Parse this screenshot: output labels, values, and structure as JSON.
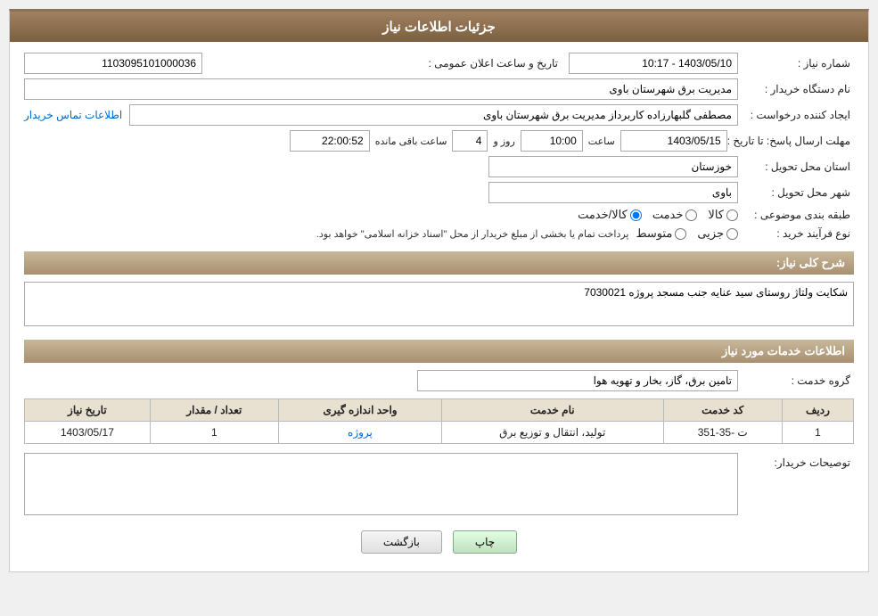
{
  "header": {
    "title": "جزئیات اطلاعات نیاز"
  },
  "fields": {
    "shomara_niaz_label": "شماره نیاز :",
    "shomara_niaz_value": "1103095101000036",
    "nam_dastgah_label": "نام دستگاه خریدار :",
    "nam_dastgah_value": "مدیریت برق شهرستان باوی",
    "ijad_konande_label": "ایجاد کننده درخواست :",
    "ijad_konande_value": "مصطفی گلبهارزاده کاربرداز مدیریت برق شهرستان باوی",
    "ettelaat_tamas_link": "اطلاعات تماس خریدار",
    "mohlat_label": "مهلت ارسال پاسخ: تا تاریخ :",
    "date_value": "1403/05/15",
    "saat_label": "ساعت",
    "saat_value": "10:00",
    "roz_label": "روز و",
    "roz_value": "4",
    "bagi_mande_label": "ساعت باقی مانده",
    "bagi_mande_value": "22:00:52",
    "ostan_label": "استان محل تحویل :",
    "ostan_value": "خوزستان",
    "shahr_label": "شهر محل تحویل :",
    "shahr_value": "باوی",
    "tabaqe_label": "طبقه بندی موضوعی :",
    "radio_kala_label": "کالا",
    "radio_khedmat_label": "خدمت",
    "radio_kala_khedmat_label": "کالا/خدمت",
    "radio_kala_checked": false,
    "radio_khedmat_checked": false,
    "radio_kala_khedmat_checked": true,
    "noe_farayand_label": "نوع فرآیند خرید :",
    "radio_jozi_label": "جزیی",
    "radio_motavsat_label": "متوسط",
    "radio_payment_text": "پرداخت تمام یا بخشی از مبلغ خریدار از محل \"اسناد خزانه اسلامی\" خواهد بود.",
    "sharh_koli_label": "شرح کلی نیاز:",
    "sharh_koli_value": "شکایت ولتاژ روستای سید عنایه جنب مسجد پروژه 7030021",
    "section_khadamat_title": "اطلاعات خدمات مورد نیاز",
    "gorohe_khedmat_label": "گروه خدمت :",
    "gorohe_khedmat_value": "تامین برق، گاز، بخار و تهویه هوا",
    "table_headers": {
      "radif": "ردیف",
      "kod_khedmat": "کد خدمت",
      "nam_khedmat": "نام خدمت",
      "vahed_andaze": "واحد اندازه گیری",
      "tedad_megdar": "تعداد / مقدار",
      "tarikh_niaz": "تاریخ نیاز"
    },
    "table_rows": [
      {
        "radif": "1",
        "kod_khedmat": "ت -35-351",
        "nam_khedmat": "تولید، انتقال و توزیع برق",
        "vahed_andaze": "پروژه",
        "tedad_megdar": "1",
        "tarikh_niaz": "1403/05/17"
      }
    ],
    "tosih_label": "توصیحات خریدار:",
    "tosih_value": "",
    "btn_chap": "چاپ",
    "btn_bazgasht": "بازگشت",
    "tarikh_elan_label": "تاریخ و ساعت اعلان عمومی :",
    "tarikh_elan_value": "1403/05/10 - 10:17"
  }
}
